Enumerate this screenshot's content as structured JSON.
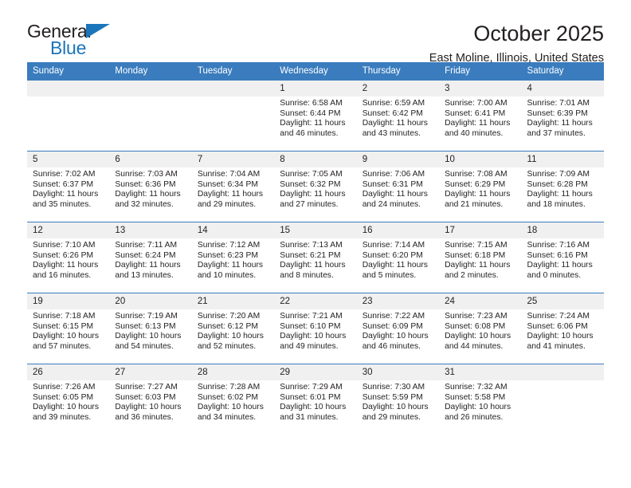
{
  "brand": {
    "word_one": "General",
    "word_two": "Blue",
    "triangle_icon": "triangle-icon"
  },
  "header": {
    "title": "October 2025",
    "location": "East Moline, Illinois, United States"
  },
  "theme": {
    "header_blue": "#3a7cbe",
    "brand_blue": "#1b75bb",
    "daynum_band": "#f0f0f0",
    "text": "#231f20"
  },
  "calendar": {
    "weekday_headers": [
      "Sunday",
      "Monday",
      "Tuesday",
      "Wednesday",
      "Thursday",
      "Friday",
      "Saturday"
    ],
    "labels": {
      "sunrise": "Sunrise:",
      "sunset": "Sunset:",
      "daylight": "Daylight:"
    },
    "weeks": [
      [
        {
          "day": "",
          "blank": true
        },
        {
          "day": "",
          "blank": true
        },
        {
          "day": "",
          "blank": true
        },
        {
          "day": "1",
          "sunrise": "Sunrise: 6:58 AM",
          "sunset": "Sunset: 6:44 PM",
          "daylight_1": "Daylight: 11 hours",
          "daylight_2": "and 46 minutes."
        },
        {
          "day": "2",
          "sunrise": "Sunrise: 6:59 AM",
          "sunset": "Sunset: 6:42 PM",
          "daylight_1": "Daylight: 11 hours",
          "daylight_2": "and 43 minutes."
        },
        {
          "day": "3",
          "sunrise": "Sunrise: 7:00 AM",
          "sunset": "Sunset: 6:41 PM",
          "daylight_1": "Daylight: 11 hours",
          "daylight_2": "and 40 minutes."
        },
        {
          "day": "4",
          "sunrise": "Sunrise: 7:01 AM",
          "sunset": "Sunset: 6:39 PM",
          "daylight_1": "Daylight: 11 hours",
          "daylight_2": "and 37 minutes."
        }
      ],
      [
        {
          "day": "5",
          "sunrise": "Sunrise: 7:02 AM",
          "sunset": "Sunset: 6:37 PM",
          "daylight_1": "Daylight: 11 hours",
          "daylight_2": "and 35 minutes."
        },
        {
          "day": "6",
          "sunrise": "Sunrise: 7:03 AM",
          "sunset": "Sunset: 6:36 PM",
          "daylight_1": "Daylight: 11 hours",
          "daylight_2": "and 32 minutes."
        },
        {
          "day": "7",
          "sunrise": "Sunrise: 7:04 AM",
          "sunset": "Sunset: 6:34 PM",
          "daylight_1": "Daylight: 11 hours",
          "daylight_2": "and 29 minutes."
        },
        {
          "day": "8",
          "sunrise": "Sunrise: 7:05 AM",
          "sunset": "Sunset: 6:32 PM",
          "daylight_1": "Daylight: 11 hours",
          "daylight_2": "and 27 minutes."
        },
        {
          "day": "9",
          "sunrise": "Sunrise: 7:06 AM",
          "sunset": "Sunset: 6:31 PM",
          "daylight_1": "Daylight: 11 hours",
          "daylight_2": "and 24 minutes."
        },
        {
          "day": "10",
          "sunrise": "Sunrise: 7:08 AM",
          "sunset": "Sunset: 6:29 PM",
          "daylight_1": "Daylight: 11 hours",
          "daylight_2": "and 21 minutes."
        },
        {
          "day": "11",
          "sunrise": "Sunrise: 7:09 AM",
          "sunset": "Sunset: 6:28 PM",
          "daylight_1": "Daylight: 11 hours",
          "daylight_2": "and 18 minutes."
        }
      ],
      [
        {
          "day": "12",
          "sunrise": "Sunrise: 7:10 AM",
          "sunset": "Sunset: 6:26 PM",
          "daylight_1": "Daylight: 11 hours",
          "daylight_2": "and 16 minutes."
        },
        {
          "day": "13",
          "sunrise": "Sunrise: 7:11 AM",
          "sunset": "Sunset: 6:24 PM",
          "daylight_1": "Daylight: 11 hours",
          "daylight_2": "and 13 minutes."
        },
        {
          "day": "14",
          "sunrise": "Sunrise: 7:12 AM",
          "sunset": "Sunset: 6:23 PM",
          "daylight_1": "Daylight: 11 hours",
          "daylight_2": "and 10 minutes."
        },
        {
          "day": "15",
          "sunrise": "Sunrise: 7:13 AM",
          "sunset": "Sunset: 6:21 PM",
          "daylight_1": "Daylight: 11 hours",
          "daylight_2": "and 8 minutes."
        },
        {
          "day": "16",
          "sunrise": "Sunrise: 7:14 AM",
          "sunset": "Sunset: 6:20 PM",
          "daylight_1": "Daylight: 11 hours",
          "daylight_2": "and 5 minutes."
        },
        {
          "day": "17",
          "sunrise": "Sunrise: 7:15 AM",
          "sunset": "Sunset: 6:18 PM",
          "daylight_1": "Daylight: 11 hours",
          "daylight_2": "and 2 minutes."
        },
        {
          "day": "18",
          "sunrise": "Sunrise: 7:16 AM",
          "sunset": "Sunset: 6:16 PM",
          "daylight_1": "Daylight: 11 hours",
          "daylight_2": "and 0 minutes."
        }
      ],
      [
        {
          "day": "19",
          "sunrise": "Sunrise: 7:18 AM",
          "sunset": "Sunset: 6:15 PM",
          "daylight_1": "Daylight: 10 hours",
          "daylight_2": "and 57 minutes."
        },
        {
          "day": "20",
          "sunrise": "Sunrise: 7:19 AM",
          "sunset": "Sunset: 6:13 PM",
          "daylight_1": "Daylight: 10 hours",
          "daylight_2": "and 54 minutes."
        },
        {
          "day": "21",
          "sunrise": "Sunrise: 7:20 AM",
          "sunset": "Sunset: 6:12 PM",
          "daylight_1": "Daylight: 10 hours",
          "daylight_2": "and 52 minutes."
        },
        {
          "day": "22",
          "sunrise": "Sunrise: 7:21 AM",
          "sunset": "Sunset: 6:10 PM",
          "daylight_1": "Daylight: 10 hours",
          "daylight_2": "and 49 minutes."
        },
        {
          "day": "23",
          "sunrise": "Sunrise: 7:22 AM",
          "sunset": "Sunset: 6:09 PM",
          "daylight_1": "Daylight: 10 hours",
          "daylight_2": "and 46 minutes."
        },
        {
          "day": "24",
          "sunrise": "Sunrise: 7:23 AM",
          "sunset": "Sunset: 6:08 PM",
          "daylight_1": "Daylight: 10 hours",
          "daylight_2": "and 44 minutes."
        },
        {
          "day": "25",
          "sunrise": "Sunrise: 7:24 AM",
          "sunset": "Sunset: 6:06 PM",
          "daylight_1": "Daylight: 10 hours",
          "daylight_2": "and 41 minutes."
        }
      ],
      [
        {
          "day": "26",
          "sunrise": "Sunrise: 7:26 AM",
          "sunset": "Sunset: 6:05 PM",
          "daylight_1": "Daylight: 10 hours",
          "daylight_2": "and 39 minutes."
        },
        {
          "day": "27",
          "sunrise": "Sunrise: 7:27 AM",
          "sunset": "Sunset: 6:03 PM",
          "daylight_1": "Daylight: 10 hours",
          "daylight_2": "and 36 minutes."
        },
        {
          "day": "28",
          "sunrise": "Sunrise: 7:28 AM",
          "sunset": "Sunset: 6:02 PM",
          "daylight_1": "Daylight: 10 hours",
          "daylight_2": "and 34 minutes."
        },
        {
          "day": "29",
          "sunrise": "Sunrise: 7:29 AM",
          "sunset": "Sunset: 6:01 PM",
          "daylight_1": "Daylight: 10 hours",
          "daylight_2": "and 31 minutes."
        },
        {
          "day": "30",
          "sunrise": "Sunrise: 7:30 AM",
          "sunset": "Sunset: 5:59 PM",
          "daylight_1": "Daylight: 10 hours",
          "daylight_2": "and 29 minutes."
        },
        {
          "day": "31",
          "sunrise": "Sunrise: 7:32 AM",
          "sunset": "Sunset: 5:58 PM",
          "daylight_1": "Daylight: 10 hours",
          "daylight_2": "and 26 minutes."
        },
        {
          "day": "",
          "blank": true
        }
      ]
    ]
  }
}
